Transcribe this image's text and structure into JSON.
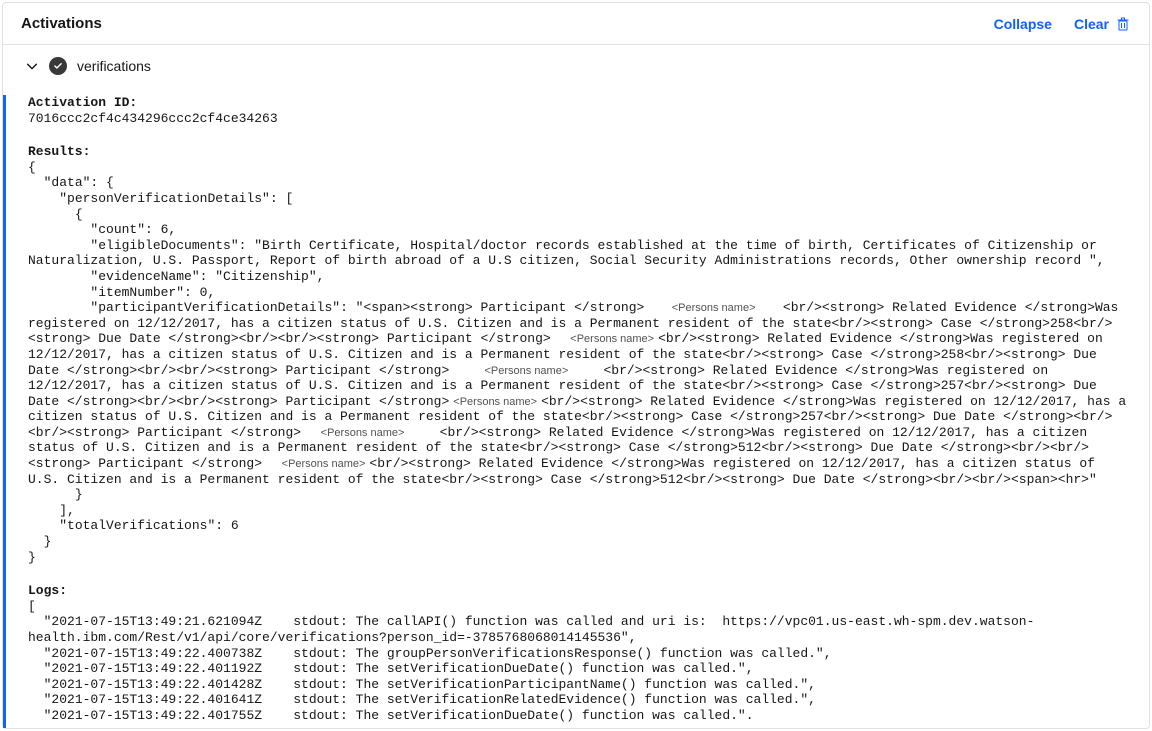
{
  "header": {
    "title": "Activations",
    "collapse_label": "Collapse",
    "clear_label": "Clear"
  },
  "activation": {
    "name": "verifications",
    "id_label": "Activation ID:",
    "id_value": "7016ccc2cf4c434296ccc2cf4ce34263",
    "results_label": "Results:",
    "logs_label": "Logs:"
  },
  "pii_placeholder": "<Persons name>",
  "results_segments": [
    {
      "t": "{\n  \"data\": {\n    \"personVerificationDetails\": [\n      {\n        \"count\": 6,\n        \"eligibleDocuments\": \"Birth Certificate, Hospital/doctor records established at the time of birth, Certificates of Citizenship or Naturalization, U.S. Passport, Report of birth abroad of a U.S citizen, Social Security Administrations records, Other ownership record \",\n        \"evidenceName\": \"Citizenship\",\n        \"itemNumber\": 0,\n        \"participantVerificationDetails\": \"<span><strong> Participant </strong>   "
    },
    {
      "pii": true
    },
    {
      "t": "   <br/><strong> Related Evidence </strong>Was registered on 12/12/2017, has a citizen status of U.S. Citizen and is a Permanent resident of the state<br/><strong> Case </strong>258<br/><strong> Due Date </strong><br/><br/><strong> Participant </strong>  "
    },
    {
      "pii": true
    },
    {
      "t": "<br/><strong> Related Evidence </strong>Was registered on 12/12/2017, has a citizen status of U.S. Citizen and is a Permanent resident of the state<br/><strong> Case </strong>258<br/><strong> Due Date </strong><br/><br/><strong> Participant </strong>    "
    },
    {
      "pii": true
    },
    {
      "t": "    <br/><strong> Related Evidence </strong>Was registered on 12/12/2017, has a citizen status of U.S. Citizen and is a Permanent resident of the state<br/><strong> Case </strong>257<br/><strong> Due Date </strong><br/><br/><strong> Participant </strong>"
    },
    {
      "pii": true
    },
    {
      "t": "<br/><strong> Related Evidence </strong>Was registered on 12/12/2017, has a citizen status of U.S. Citizen and is a Permanent resident of the state<br/><strong> Case </strong>257<br/><strong> Due Date </strong><br/><br/><strong> Participant </strong>  "
    },
    {
      "pii": true
    },
    {
      "t": "    <br/><strong> Related Evidence </strong>Was registered on 12/12/2017, has a citizen status of U.S. Citizen and is a Permanent resident of the state<br/><strong> Case </strong>512<br/><strong> Due Date </strong><br/><br/><strong> Participant </strong>  "
    },
    {
      "pii": true
    },
    {
      "t": "<br/><strong> Related Evidence </strong>Was registered on 12/12/2017, has a citizen status of U.S. Citizen and is a Permanent resident of the state<br/><strong> Case </strong>512<br/><strong> Due Date </strong><br/><br/><span><hr>\"\n      }\n    ],\n    \"totalVerifications\": 6\n  }\n}"
    }
  ],
  "logs_text": "[\n  \"2021-07-15T13:49:21.621094Z    stdout: The callAPI() function was called and uri is:  https://vpc01.us-east.wh-spm.dev.watson-health.ibm.com/Rest/v1/api/core/verifications?person_id=-3785768068014145536\",\n  \"2021-07-15T13:49:22.400738Z    stdout: The groupPersonVerificationsResponse() function was called.\",\n  \"2021-07-15T13:49:22.401192Z    stdout: The setVerificationDueDate() function was called.\",\n  \"2021-07-15T13:49:22.401428Z    stdout: The setVerificationParticipantName() function was called.\",\n  \"2021-07-15T13:49:22.401641Z    stdout: The setVerificationRelatedEvidence() function was called.\",\n  \"2021-07-15T13:49:22.401755Z    stdout: The setVerificationDueDate() function was called.\"."
}
